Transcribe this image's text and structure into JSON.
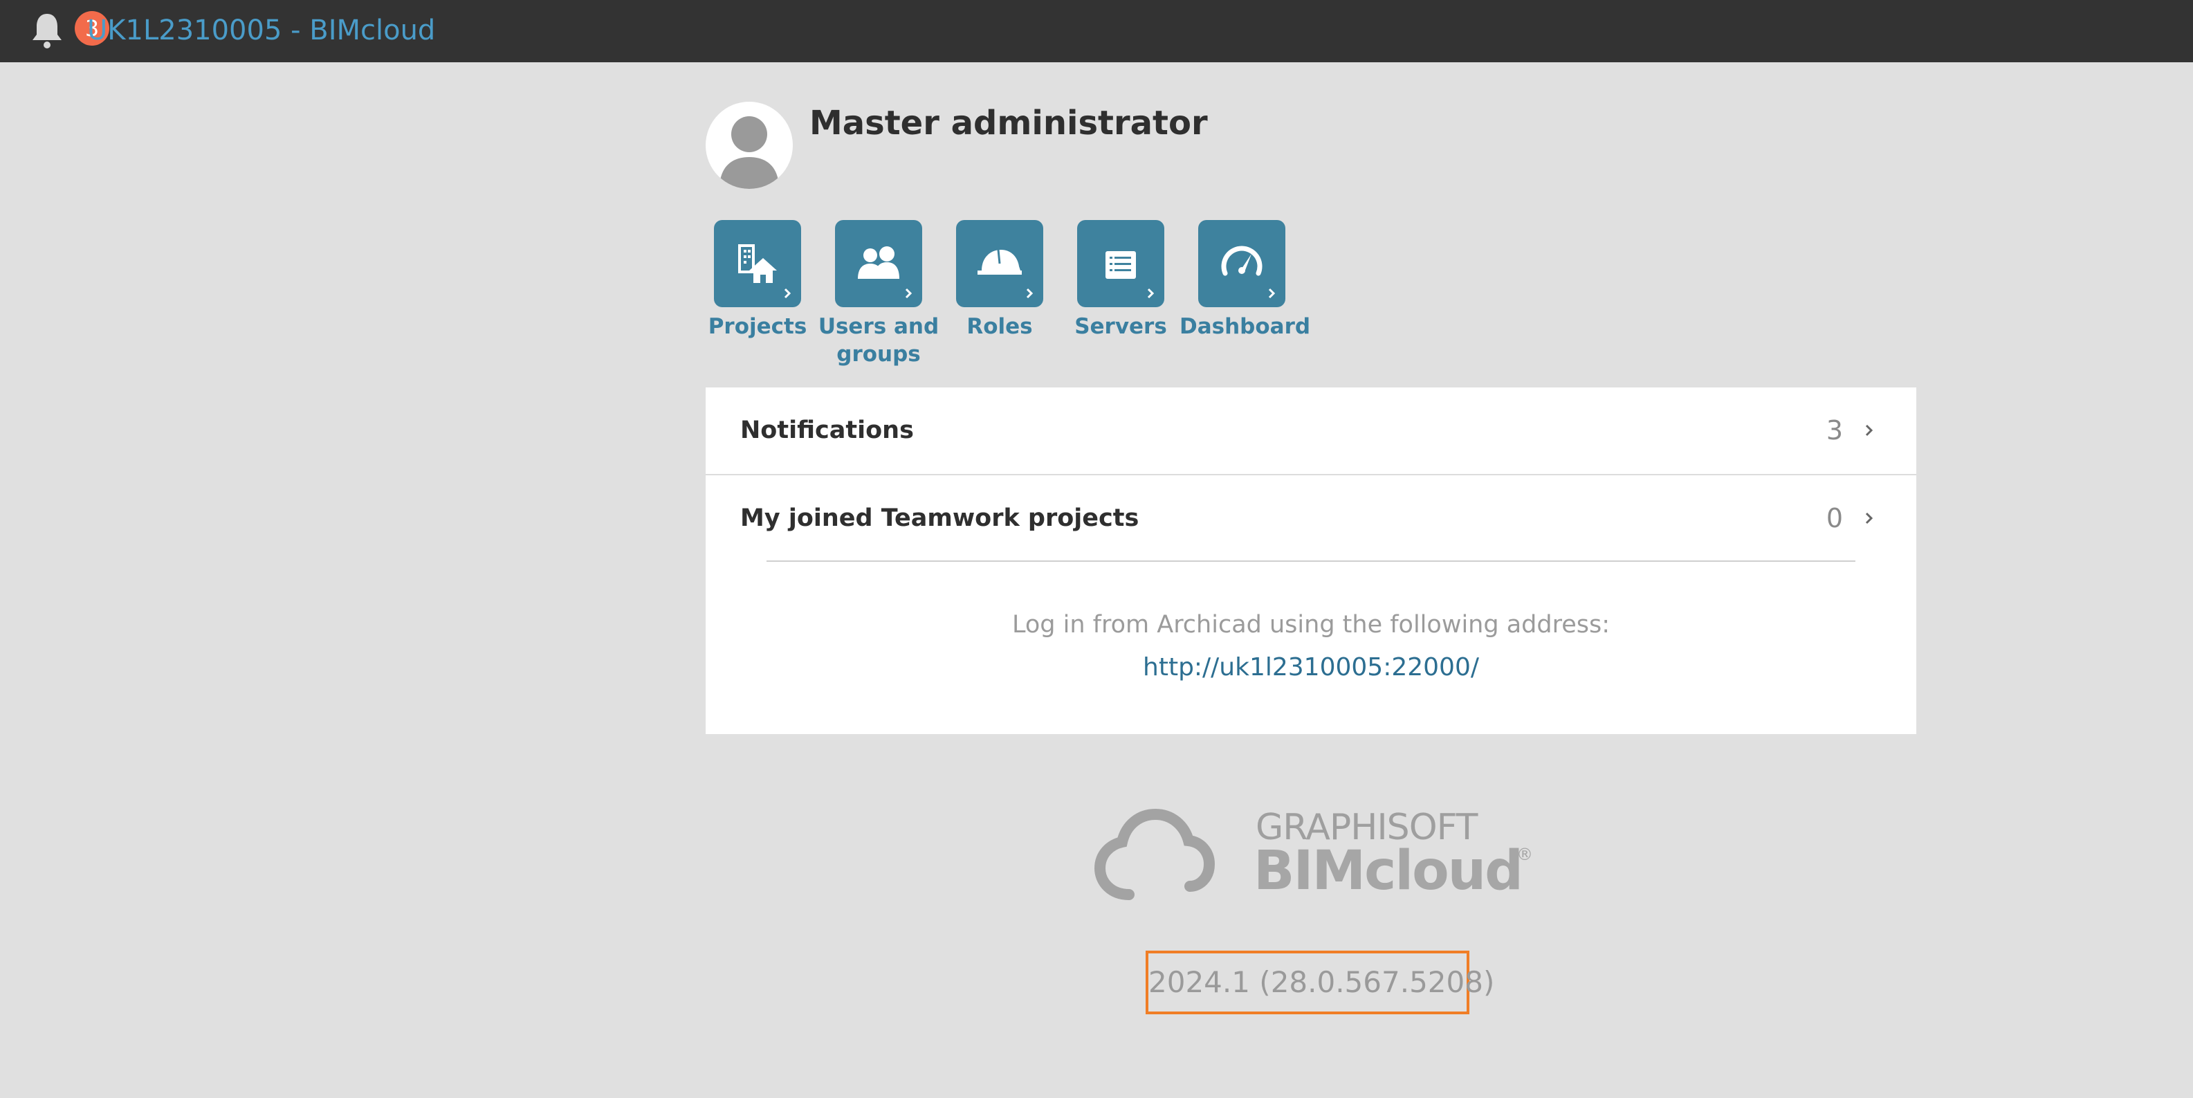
{
  "header": {
    "title": "UK1L2310005 - BIMcloud",
    "notification_count": "3"
  },
  "user": {
    "name": "Master administrator"
  },
  "nav_tiles": [
    {
      "label": "Projects",
      "icon": "projects-icon"
    },
    {
      "label": "Users and groups",
      "icon": "users-groups-icon"
    },
    {
      "label": "Roles",
      "icon": "hard-hat-icon"
    },
    {
      "label": "Servers",
      "icon": "server-icon"
    },
    {
      "label": "Dashboard",
      "icon": "gauge-icon"
    }
  ],
  "panel": {
    "notifications": {
      "label": "Notifications",
      "count": "3"
    },
    "joined_projects": {
      "label": "My joined Teamwork projects",
      "count": "0"
    },
    "login_text": "Log in from Archicad using the following address:",
    "login_url": "http://uk1l2310005:22000/"
  },
  "logo": {
    "company": "GRAPHISOFT",
    "product": "BIMcloud",
    "registered": "®"
  },
  "version": "2024.1 (28.0.567.5208)",
  "colors": {
    "topbar": "#333333",
    "accent": "#3e829e",
    "badge": "#f26b4b",
    "highlight": "#f07e26"
  }
}
